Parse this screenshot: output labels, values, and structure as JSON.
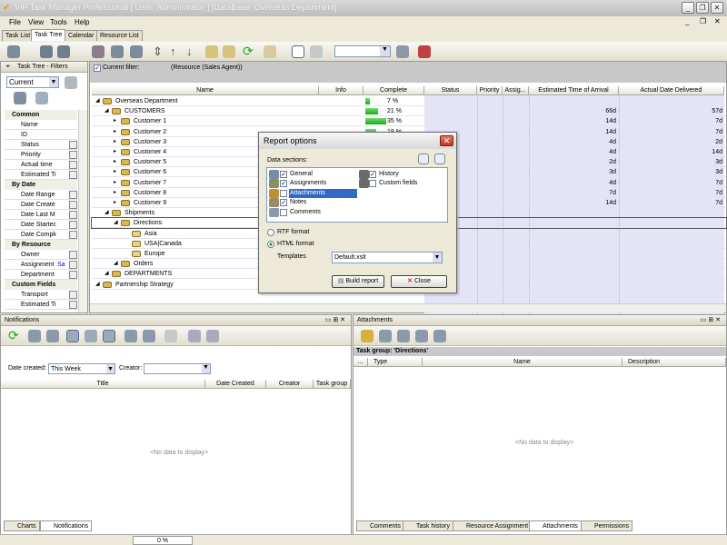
{
  "window": {
    "title": "VIP Task Manager Professional [ User: Administrator ] [DataBase: Overseas Department]"
  },
  "menu": [
    "File",
    "View",
    "Tools",
    "Help"
  ],
  "tabs": [
    "Task List",
    "Task Tree",
    "Calendar",
    "Resource List"
  ],
  "left_panel": {
    "title": "Task Tree - Filters",
    "view_select": "Current",
    "categories": [
      {
        "name": "Common",
        "rows": [
          "Name",
          "ID",
          "Status",
          "Priority",
          "Actual time",
          "Estimated Ti"
        ]
      },
      {
        "name": "By Date",
        "rows": [
          "Date Range",
          "Date Create",
          "Date Last M",
          "Date Startec",
          "Date Compk"
        ]
      },
      {
        "name": "By Resource",
        "rows": [
          "Owner",
          "Assignment",
          "Department"
        ]
      },
      {
        "name": "Custom Fields",
        "rows": [
          "Transport",
          "Estimated Ti"
        ]
      }
    ],
    "assignment_value": "Sa"
  },
  "filter_bar": {
    "label": "Current filter:",
    "value": "(Resource (Sales Agent))"
  },
  "grid": {
    "columns": [
      "Name",
      "Info",
      "Complete",
      "Status",
      "Priority",
      "Assig...",
      "Estimated Time of Arrival",
      "Actual Date Delivered"
    ],
    "rows": [
      {
        "name": "Overseas Department",
        "level": 0,
        "complete": "7 %",
        "pct": 7,
        "eta": "",
        "actual": ""
      },
      {
        "name": "CUSTOMERS",
        "level": 1,
        "complete": "21 %",
        "pct": 21,
        "eta": "66d",
        "actual": "57d"
      },
      {
        "name": "Customer 1",
        "level": 2,
        "complete": "35 %",
        "pct": 35,
        "eta": "14d",
        "actual": "7d"
      },
      {
        "name": "Customer 2",
        "level": 2,
        "complete": "18 %",
        "pct": 18,
        "eta": "14d",
        "actual": "7d"
      },
      {
        "name": "Customer 3",
        "level": 2,
        "complete": "",
        "pct": 0,
        "eta": "4d",
        "actual": "2d"
      },
      {
        "name": "Customer 4",
        "level": 2,
        "complete": "",
        "pct": 0,
        "eta": "4d",
        "actual": "14d"
      },
      {
        "name": "Customer 5",
        "level": 2,
        "complete": "",
        "pct": 0,
        "eta": "2d",
        "actual": "3d"
      },
      {
        "name": "Customer 6",
        "level": 2,
        "complete": "",
        "pct": 0,
        "eta": "3d",
        "actual": "3d"
      },
      {
        "name": "Customer 7",
        "level": 2,
        "complete": "",
        "pct": 0,
        "eta": "4d",
        "actual": "7d"
      },
      {
        "name": "Customer 8",
        "level": 2,
        "complete": "",
        "pct": 0,
        "eta": "7d",
        "actual": "7d"
      },
      {
        "name": "Customer 9",
        "level": 2,
        "complete": "",
        "pct": 0,
        "eta": "14d",
        "actual": "7d"
      },
      {
        "name": "Shipments",
        "level": 1,
        "complete": "",
        "pct": 0,
        "eta": "",
        "actual": ""
      },
      {
        "name": "Directions",
        "level": 2,
        "complete": "",
        "pct": 0,
        "eta": "",
        "actual": ""
      },
      {
        "name": "Asia",
        "level": 3,
        "complete": "",
        "pct": 0,
        "eta": "",
        "actual": ""
      },
      {
        "name": "USA|Canada",
        "level": 3,
        "complete": "",
        "pct": 0,
        "eta": "",
        "actual": ""
      },
      {
        "name": "Europe",
        "level": 3,
        "complete": "",
        "pct": 0,
        "eta": "",
        "actual": ""
      },
      {
        "name": "Orders",
        "level": 2,
        "complete": "",
        "pct": 0,
        "eta": "",
        "actual": ""
      },
      {
        "name": "DEPARTMENTS",
        "level": 1,
        "complete": "",
        "pct": 0,
        "eta": "",
        "actual": ""
      },
      {
        "name": "Partnership Strategy",
        "level": 0,
        "complete": "",
        "pct": 0,
        "eta": "",
        "actual": ""
      }
    ]
  },
  "notifications": {
    "title": "Notifications",
    "date_created_label": "Date created:",
    "date_created_value": "This Week",
    "creator_label": "Creator:",
    "columns": [
      "Title",
      "Date Created",
      "Creator",
      "Task group"
    ],
    "empty": "<No data to display>",
    "tabs": [
      "Charts",
      "Notifications"
    ]
  },
  "attachments": {
    "title": "Attachments",
    "group_label": "Task group: 'Directions'",
    "columns": [
      "...",
      "Type",
      "Name",
      "Description"
    ],
    "empty": "<No data to display>",
    "tabs": [
      "Comments",
      "Task history",
      "Resource Assignment",
      "Attachments",
      "Permissions"
    ]
  },
  "status": {
    "progress": "0 %"
  },
  "dialog": {
    "title": "Report options",
    "sections_label": "Data sections:",
    "sections_left": [
      {
        "label": "General",
        "checked": true
      },
      {
        "label": "Assignments",
        "checked": true
      },
      {
        "label": "Attachments",
        "checked": false,
        "selected": true
      },
      {
        "label": "Notes",
        "checked": true
      },
      {
        "label": "Comments",
        "checked": false
      }
    ],
    "sections_right": [
      {
        "label": "History",
        "checked": true
      },
      {
        "label": "Custom fields",
        "checked": false
      }
    ],
    "rtf_label": "RTF format",
    "html_label": "HTML format",
    "format": "html",
    "templates_label": "Templates",
    "template_value": "Default.xslt",
    "build_label": "Build report",
    "close_label": "Close"
  }
}
